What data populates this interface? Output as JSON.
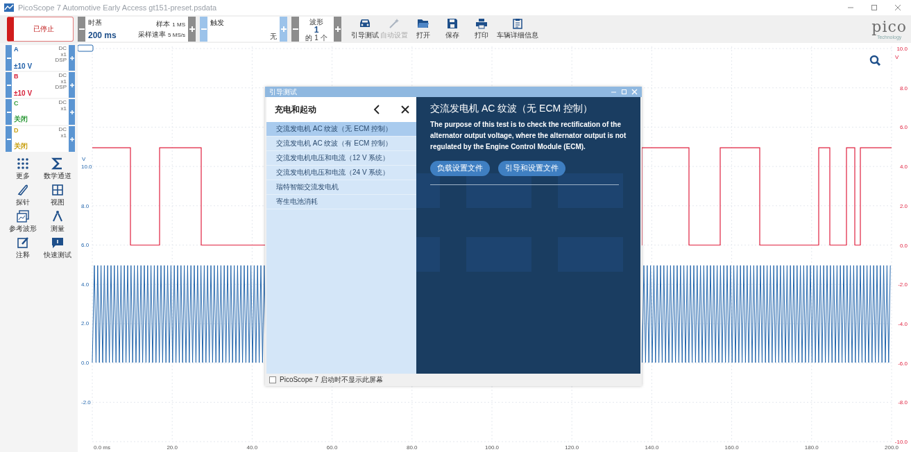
{
  "window": {
    "title": "PicoScope 7 Automotive Early Access gt151-preset.psdata"
  },
  "toolbar": {
    "run_button": {
      "label": "已停止",
      "running": false
    },
    "timebase": {
      "title": "时基",
      "value": "200 ms",
      "samples_label": "样本",
      "samples": "1 MS",
      "rate_label": "采样速率",
      "rate": "5 MS/s"
    },
    "trigger": {
      "title": "触发",
      "value": "无"
    },
    "waveform": {
      "title": "波形",
      "value": "1",
      "of": "的 1 个"
    },
    "actions": [
      {
        "kind": "car",
        "label": "引导测试",
        "disabled": false
      },
      {
        "kind": "wand",
        "label": "自动设置",
        "disabled": true
      },
      {
        "kind": "folder",
        "label": "打开",
        "disabled": false
      },
      {
        "kind": "save",
        "label": "保存",
        "disabled": false
      },
      {
        "kind": "print",
        "label": "打印",
        "disabled": false
      },
      {
        "kind": "clipboard",
        "label": "车辆详细信息",
        "disabled": false
      }
    ],
    "logo": {
      "text": "pico",
      "tagline": "Technology"
    }
  },
  "channels": [
    {
      "name": "A",
      "color": "#1f5fa8",
      "range": "±10 V",
      "coupling": [
        "DC",
        "x1",
        "DSP"
      ]
    },
    {
      "name": "B",
      "color": "#d6213a",
      "range": "±10 V",
      "coupling": [
        "DC",
        "x1",
        "DSP"
      ]
    },
    {
      "name": "C",
      "color": "#2e9a3a",
      "range": "关闭",
      "coupling": [
        "DC",
        "x1"
      ]
    },
    {
      "name": "D",
      "color": "#c9a114",
      "range": "关闭",
      "coupling": [
        "DC",
        "x1"
      ]
    }
  ],
  "tools": [
    {
      "kind": "grid",
      "label": "更多"
    },
    {
      "kind": "sigma",
      "label": "数学通道"
    },
    {
      "kind": "probe",
      "label": "探针"
    },
    {
      "kind": "view",
      "label": "视图"
    },
    {
      "kind": "reference",
      "label": "参考波形"
    },
    {
      "kind": "measure",
      "label": "测量"
    },
    {
      "kind": "notes",
      "label": "注释"
    },
    {
      "kind": "chat",
      "label": "快速测试"
    }
  ],
  "plot": {
    "left_unit": "V",
    "right_unit": "V",
    "left_ticks": [
      "10.0",
      "8.0",
      "6.0",
      "4.0",
      "2.0",
      "0.0",
      "-2.0"
    ],
    "right_ticks": [
      "10.0",
      "8.0",
      "6.0",
      "4.0",
      "2.0",
      "0.0",
      "-2.0",
      "-4.0",
      "-6.0",
      "-8.0",
      "-10.0"
    ],
    "x_ticks": [
      "0.0 ms",
      "20.0",
      "40.0",
      "60.0",
      "80.0",
      "100.0",
      "120.0",
      "140.0",
      "160.0",
      "180.0",
      "200.0"
    ]
  },
  "dialog": {
    "title": "引导测试",
    "category": "充电和起动",
    "tests": [
      {
        "label": "交流发电机 AC 纹波（无 ECM 控制）",
        "selected": true
      },
      {
        "label": "交流发电机 AC 纹波（有 ECM 控制）",
        "selected": false
      },
      {
        "label": "交流发电机电压和电流（12 V 系统）",
        "selected": false
      },
      {
        "label": "交流发电机电压和电流（24 V 系统）",
        "selected": false
      },
      {
        "label": "瑞特智能交流发电机",
        "selected": false
      },
      {
        "label": "寄生电池消耗",
        "selected": false
      }
    ],
    "heading": "交流发电机 AC 纹波（无 ECM 控制）",
    "description": "The purpose of this test is to check the rectification of the alternator output voltage, where the alternator output is not regulated by the Engine Control Module (ECM).",
    "buttons": [
      "负载设置文件",
      "引导和设置文件"
    ],
    "dont_show": {
      "label": "PicoScope 7 启动时不显示此屏幕",
      "checked": false
    }
  }
}
